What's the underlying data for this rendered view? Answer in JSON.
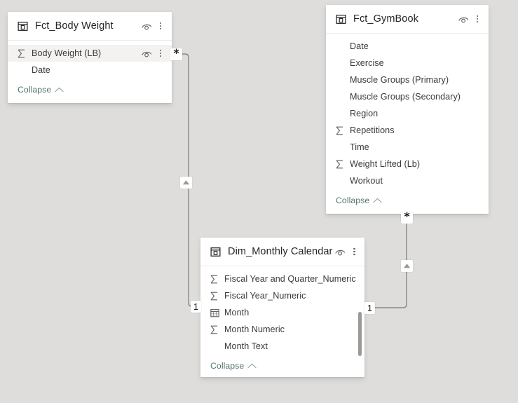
{
  "canvas": {
    "background": "#dedddb",
    "card_background": "#ffffff",
    "link_color": "#55756f",
    "line_color": "#8a8886"
  },
  "tables": [
    {
      "id": "fct_body_weight",
      "title": "Fct_Body Weight",
      "header_icon": "table-icon",
      "hide_icon": "eye-hide-icon",
      "more_icon": "more-options-icon",
      "collapse_label": "Collapse",
      "collapse_icon": "chevron-up-icon",
      "has_scrollbar": false,
      "fields": [
        {
          "name": "Body Weight (LB)",
          "icon": "sigma-icon",
          "highlighted": true,
          "row_hide_icon": "eye-hide-icon",
          "row_more_icon": "more-options-icon"
        },
        {
          "name": "Date",
          "icon": "none",
          "highlighted": false
        }
      ]
    },
    {
      "id": "fct_gymbook",
      "title": "Fct_GymBook",
      "header_icon": "table-icon",
      "hide_icon": "eye-hide-icon",
      "more_icon": "more-options-icon",
      "collapse_label": "Collapse",
      "collapse_icon": "chevron-up-icon",
      "has_scrollbar": false,
      "fields": [
        {
          "name": "Date",
          "icon": "none",
          "highlighted": false
        },
        {
          "name": "Exercise",
          "icon": "none",
          "highlighted": false
        },
        {
          "name": "Muscle Groups (Primary)",
          "icon": "none",
          "highlighted": false
        },
        {
          "name": "Muscle Groups (Secondary)",
          "icon": "none",
          "highlighted": false
        },
        {
          "name": "Region",
          "icon": "none",
          "highlighted": false
        },
        {
          "name": "Repetitions",
          "icon": "sigma-icon",
          "highlighted": false
        },
        {
          "name": "Time",
          "icon": "none",
          "highlighted": false
        },
        {
          "name": "Weight Lifted (Lb)",
          "icon": "sigma-icon",
          "highlighted": false
        },
        {
          "name": "Workout",
          "icon": "none",
          "highlighted": false
        }
      ]
    },
    {
      "id": "dim_monthly_calendar",
      "title": "Dim_Monthly Calendar",
      "header_icon": "table-icon",
      "hide_icon": "eye-hide-icon",
      "more_icon": "more-options-icon",
      "collapse_label": "Collapse",
      "collapse_icon": "chevron-up-icon",
      "has_scrollbar": true,
      "fields": [
        {
          "name": "Fiscal Year and Quarter_Numeric",
          "icon": "sigma-icon",
          "highlighted": false
        },
        {
          "name": "Fiscal Year_Numeric",
          "icon": "sigma-icon",
          "highlighted": false
        },
        {
          "name": "Month",
          "icon": "calendar-icon",
          "highlighted": false
        },
        {
          "name": "Month Numeric",
          "icon": "sigma-icon",
          "highlighted": false
        },
        {
          "name": "Month Text",
          "icon": "none",
          "highlighted": false
        }
      ]
    }
  ],
  "relationships": [
    {
      "id": "bodyweight-to-calendar",
      "from_table": "fct_body_weight",
      "to_table": "dim_monthly_calendar",
      "many_label": "*",
      "one_label": "1",
      "direction_icon": "filter-direction-up-arrow"
    },
    {
      "id": "gymbook-to-calendar",
      "from_table": "fct_gymbook",
      "to_table": "dim_monthly_calendar",
      "many_label": "*",
      "one_label": "1",
      "direction_icon": "filter-direction-up-arrow"
    }
  ]
}
